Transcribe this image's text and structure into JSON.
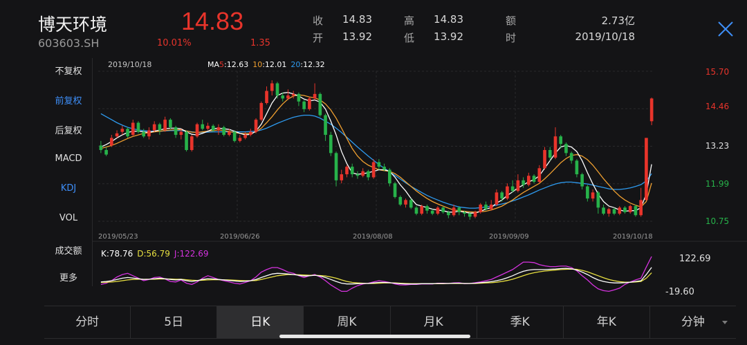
{
  "header": {
    "name": "博天环境",
    "code": "603603.SH",
    "price": "14.83",
    "change_pct": "10.01%",
    "change": "1.35",
    "quotes": [
      {
        "label": "收",
        "value": "14.83"
      },
      {
        "label": "高",
        "value": "14.83"
      },
      {
        "label": "额",
        "value": "2.73亿"
      },
      {
        "label": "开",
        "value": "13.92"
      },
      {
        "label": "低",
        "value": "13.92"
      },
      {
        "label": "时",
        "value": "2019/10/18"
      }
    ]
  },
  "sidebar": {
    "items": [
      {
        "label": "不复权"
      },
      {
        "label": "前复权",
        "active": true
      },
      {
        "label": "后复权"
      },
      {
        "label": "MACD"
      },
      {
        "label": "KDJ",
        "active": true
      },
      {
        "label": "VOL"
      },
      {
        "label": "成交额"
      },
      {
        "label": "更多"
      }
    ]
  },
  "legend": {
    "date": "2019/10/18",
    "ma_prefix": "MA",
    "ma5_key": "5",
    "ma5_val": ":12.63",
    "ma10_key": "10",
    "ma10_val": ":12.01",
    "ma20_key": "20",
    "ma20_val": ":12.32"
  },
  "kdj_legend": {
    "k": "K:78.76",
    "d": "D:56.79",
    "j": "J:122.69"
  },
  "tabs": [
    {
      "label": "分时"
    },
    {
      "label": "5日"
    },
    {
      "label": "日K",
      "active": true
    },
    {
      "label": "周K"
    },
    {
      "label": "月K"
    },
    {
      "label": "季K"
    },
    {
      "label": "年K"
    },
    {
      "label": "分钟",
      "dropdown": true
    }
  ],
  "colors": {
    "up": "#e8342b",
    "down": "#27b24a",
    "ma5": "#ffffff",
    "ma10": "#f0a030",
    "ma20": "#2e9bf0",
    "k_line": "#ffffff",
    "d_line": "#e8e040",
    "j_line": "#d633e0",
    "active_blue": "#3e8ef7"
  },
  "chart_data": {
    "type": "candlestick",
    "price_ticks": [
      "15.70",
      "14.46",
      "13.23",
      "11.99",
      "10.75"
    ],
    "ylim": [
      10.75,
      15.7
    ],
    "x_labels": [
      "2019/05/23",
      "2019/06/26",
      "2019/08/08",
      "2019/09/09",
      "2019/10/18"
    ],
    "kdj_ticks": [
      "122.69",
      "-19.60"
    ],
    "kdj_ylim": [
      -19.6,
      122.69
    ],
    "candles": [
      [
        13.25,
        13.1,
        13.4,
        13.0
      ],
      [
        13.1,
        12.95,
        13.2,
        12.9
      ],
      [
        13.25,
        13.5,
        13.6,
        13.2
      ],
      [
        13.55,
        13.65,
        13.75,
        13.5
      ],
      [
        13.7,
        13.8,
        13.9,
        13.6
      ],
      [
        13.8,
        13.55,
        13.85,
        13.5
      ],
      [
        13.6,
        14.0,
        14.1,
        13.55
      ],
      [
        14.0,
        13.7,
        14.05,
        13.65
      ],
      [
        13.7,
        13.55,
        13.8,
        13.5
      ],
      [
        13.55,
        13.75,
        13.85,
        13.45
      ],
      [
        13.75,
        13.95,
        14.05,
        13.7
      ],
      [
        13.95,
        13.75,
        14.0,
        13.6
      ],
      [
        13.75,
        14.1,
        14.2,
        13.7
      ],
      [
        14.1,
        13.85,
        14.15,
        13.8
      ],
      [
        13.85,
        13.6,
        13.9,
        13.5
      ],
      [
        13.6,
        13.7,
        13.8,
        13.45
      ],
      [
        13.7,
        13.1,
        13.75,
        13.05
      ],
      [
        13.1,
        13.55,
        13.6,
        13.05
      ],
      [
        13.55,
        13.95,
        14.0,
        13.5
      ],
      [
        13.95,
        13.8,
        14.1,
        13.75
      ],
      [
        13.8,
        13.9,
        14.0,
        13.75
      ],
      [
        13.9,
        13.75,
        13.95,
        13.7
      ],
      [
        13.75,
        13.85,
        13.95,
        13.6
      ],
      [
        13.85,
        13.6,
        13.9,
        13.55
      ],
      [
        13.6,
        13.7,
        13.8,
        13.55
      ],
      [
        13.7,
        13.4,
        13.75,
        13.35
      ],
      [
        13.4,
        13.5,
        13.6,
        13.35
      ],
      [
        13.5,
        13.6,
        13.7,
        13.45
      ],
      [
        13.6,
        13.7,
        13.8,
        13.55
      ],
      [
        13.7,
        14.1,
        14.15,
        13.65
      ],
      [
        14.1,
        14.65,
        14.7,
        14.05
      ],
      [
        14.65,
        15.05,
        15.2,
        14.6
      ],
      [
        15.05,
        15.3,
        15.4,
        14.9
      ],
      [
        15.3,
        14.9,
        15.35,
        14.8
      ],
      [
        14.9,
        14.8,
        15.0,
        14.7
      ],
      [
        14.8,
        14.9,
        15.1,
        14.75
      ],
      [
        14.9,
        14.95,
        15.05,
        14.8
      ],
      [
        14.95,
        14.7,
        15.0,
        14.55
      ],
      [
        14.7,
        14.45,
        14.75,
        14.35
      ],
      [
        14.45,
        14.8,
        14.85,
        14.4
      ],
      [
        14.8,
        14.95,
        15.3,
        14.75
      ],
      [
        14.95,
        14.25,
        15.0,
        14.2
      ],
      [
        14.25,
        13.6,
        14.3,
        13.4
      ],
      [
        13.6,
        13.0,
        13.7,
        12.9
      ],
      [
        13.0,
        12.1,
        13.05,
        11.9
      ],
      [
        12.1,
        12.3,
        12.45,
        12.0
      ],
      [
        12.3,
        12.55,
        12.6,
        12.2
      ],
      [
        12.55,
        12.3,
        12.65,
        12.2
      ],
      [
        12.3,
        12.25,
        12.4,
        12.15
      ],
      [
        12.25,
        12.4,
        12.5,
        12.2
      ],
      [
        12.4,
        12.2,
        12.45,
        12.1
      ],
      [
        12.2,
        12.7,
        12.8,
        12.15
      ],
      [
        12.7,
        12.55,
        12.8,
        12.45
      ],
      [
        12.55,
        12.45,
        12.65,
        12.4
      ],
      [
        12.45,
        12.0,
        12.5,
        11.9
      ],
      [
        12.0,
        11.55,
        12.05,
        11.5
      ],
      [
        11.55,
        11.3,
        11.6,
        11.25
      ],
      [
        11.3,
        11.45,
        11.5,
        11.2
      ],
      [
        11.45,
        11.2,
        11.5,
        11.15
      ],
      [
        11.2,
        11.0,
        11.25,
        10.95
      ],
      [
        11.0,
        11.25,
        11.3,
        10.95
      ],
      [
        11.25,
        11.1,
        11.3,
        11.0
      ],
      [
        11.1,
        11.0,
        11.15,
        10.95
      ],
      [
        11.0,
        11.2,
        11.25,
        10.95
      ],
      [
        11.2,
        11.05,
        11.25,
        11.0
      ],
      [
        11.05,
        10.95,
        11.1,
        10.85
      ],
      [
        10.95,
        11.2,
        11.3,
        10.9
      ],
      [
        11.2,
        11.05,
        11.25,
        10.95
      ],
      [
        11.05,
        11.0,
        11.1,
        10.9
      ],
      [
        11.0,
        10.9,
        11.05,
        10.8
      ],
      [
        10.9,
        11.05,
        11.1,
        10.85
      ],
      [
        11.05,
        11.3,
        11.35,
        11.0
      ],
      [
        11.3,
        11.15,
        11.4,
        11.1
      ],
      [
        11.15,
        11.3,
        11.45,
        11.1
      ],
      [
        11.3,
        11.7,
        11.8,
        11.25
      ],
      [
        11.7,
        11.5,
        11.75,
        11.4
      ],
      [
        11.5,
        11.9,
        12.0,
        11.45
      ],
      [
        11.9,
        11.75,
        12.1,
        11.7
      ],
      [
        11.75,
        12.1,
        12.3,
        11.7
      ],
      [
        12.1,
        11.95,
        12.2,
        11.85
      ],
      [
        11.95,
        12.25,
        12.35,
        11.9
      ],
      [
        12.25,
        12.05,
        12.3,
        12.0
      ],
      [
        12.05,
        12.5,
        12.6,
        12.0
      ],
      [
        12.5,
        13.1,
        13.2,
        12.45
      ],
      [
        13.1,
        12.85,
        13.2,
        12.75
      ],
      [
        12.85,
        13.55,
        13.85,
        12.8
      ],
      [
        13.55,
        13.3,
        13.6,
        13.15
      ],
      [
        13.3,
        13.0,
        13.35,
        12.9
      ],
      [
        13.0,
        12.75,
        13.05,
        12.65
      ],
      [
        12.75,
        12.3,
        12.8,
        12.2
      ],
      [
        12.3,
        11.9,
        12.35,
        11.8
      ],
      [
        11.9,
        11.5,
        11.95,
        11.4
      ],
      [
        11.5,
        11.7,
        11.8,
        11.4
      ],
      [
        11.7,
        11.2,
        11.75,
        11.0
      ],
      [
        11.2,
        11.0,
        11.3,
        10.95
      ],
      [
        11.0,
        11.15,
        11.2,
        10.9
      ],
      [
        11.15,
        11.0,
        11.2,
        10.95
      ],
      [
        11.0,
        11.2,
        11.25,
        10.95
      ],
      [
        11.2,
        11.05,
        11.25,
        11.0
      ],
      [
        11.05,
        11.25,
        11.3,
        11.0
      ],
      [
        11.25,
        10.95,
        11.3,
        10.9
      ],
      [
        10.95,
        11.45,
        11.85,
        10.9
      ],
      [
        11.45,
        13.5,
        13.5,
        11.45
      ],
      [
        14.05,
        14.8,
        14.83,
        13.92
      ]
    ],
    "ma5": [
      13.2,
      13.28,
      13.38,
      13.5,
      13.6,
      13.68,
      13.72,
      13.72,
      13.7,
      13.68,
      13.72,
      13.76,
      13.8,
      13.82,
      13.82,
      13.8,
      13.7,
      13.62,
      13.6,
      13.65,
      13.72,
      13.8,
      13.82,
      13.8,
      13.78,
      13.72,
      13.65,
      13.6,
      13.62,
      13.72,
      13.95,
      14.3,
      14.65,
      14.9,
      14.98,
      15.0,
      14.95,
      14.88,
      14.78,
      14.72,
      14.75,
      14.68,
      14.45,
      14.05,
      13.6,
      13.05,
      12.65,
      12.35,
      12.3,
      12.32,
      12.35,
      12.4,
      12.45,
      12.45,
      12.4,
      12.2,
      11.95,
      11.75,
      11.5,
      11.3,
      11.25,
      11.2,
      11.15,
      11.12,
      11.1,
      11.05,
      11.05,
      11.08,
      11.05,
      11.02,
      11.02,
      11.08,
      11.15,
      11.2,
      11.35,
      11.45,
      11.6,
      11.72,
      11.85,
      11.95,
      12.05,
      12.12,
      12.25,
      12.5,
      12.75,
      13.0,
      13.2,
      13.25,
      13.2,
      13.05,
      12.75,
      12.35,
      11.98,
      11.65,
      11.4,
      11.25,
      11.2,
      11.12,
      11.08,
      11.1,
      11.1,
      11.2,
      11.65,
      12.63
    ],
    "ma10": [
      13.15,
      13.2,
      13.25,
      13.32,
      13.4,
      13.48,
      13.55,
      13.6,
      13.65,
      13.67,
      13.7,
      13.72,
      13.74,
      13.76,
      13.77,
      13.77,
      13.73,
      13.69,
      13.68,
      13.7,
      13.72,
      13.74,
      13.76,
      13.74,
      13.71,
      13.68,
      13.65,
      13.64,
      13.65,
      13.7,
      13.82,
      14.0,
      14.2,
      14.42,
      14.62,
      14.78,
      14.88,
      14.92,
      14.9,
      14.85,
      14.82,
      14.75,
      14.62,
      14.42,
      14.15,
      13.82,
      13.48,
      13.15,
      12.9,
      12.72,
      12.6,
      12.52,
      12.45,
      12.42,
      12.4,
      12.32,
      12.2,
      12.05,
      11.9,
      11.75,
      11.62,
      11.5,
      11.4,
      11.32,
      11.25,
      11.18,
      11.12,
      11.1,
      11.08,
      11.06,
      11.05,
      11.06,
      11.08,
      11.12,
      11.18,
      11.25,
      11.35,
      11.45,
      11.58,
      11.7,
      11.8,
      11.9,
      12.0,
      12.15,
      12.32,
      12.5,
      12.68,
      12.82,
      12.92,
      12.95,
      12.9,
      12.78,
      12.6,
      12.38,
      12.15,
      11.95,
      11.75,
      11.58,
      11.45,
      11.35,
      11.28,
      11.22,
      11.4,
      12.01
    ],
    "ma20": [
      14.3,
      14.2,
      14.1,
      14.0,
      13.92,
      13.85,
      13.8,
      13.76,
      13.74,
      13.72,
      13.72,
      13.72,
      13.73,
      13.74,
      13.74,
      13.74,
      13.72,
      13.7,
      13.68,
      13.68,
      13.69,
      13.7,
      13.7,
      13.7,
      13.7,
      13.7,
      13.7,
      13.7,
      13.71,
      13.72,
      13.76,
      13.82,
      13.9,
      13.98,
      14.05,
      14.12,
      14.18,
      14.22,
      14.25,
      14.25,
      14.22,
      14.15,
      14.05,
      13.95,
      13.82,
      13.68,
      13.52,
      13.36,
      13.2,
      13.05,
      12.9,
      12.76,
      12.62,
      12.5,
      12.38,
      12.26,
      12.14,
      12.02,
      11.9,
      11.8,
      11.7,
      11.6,
      11.52,
      11.45,
      11.38,
      11.32,
      11.27,
      11.22,
      11.2,
      11.18,
      11.18,
      11.2,
      11.22,
      11.25,
      11.28,
      11.32,
      11.36,
      11.42,
      11.48,
      11.55,
      11.62,
      11.7,
      11.78,
      11.85,
      11.92,
      11.98,
      12.02,
      12.04,
      12.04,
      12.02,
      12.0,
      11.98,
      11.94,
      11.9,
      11.86,
      11.82,
      11.8,
      11.8,
      11.82,
      11.85,
      11.9,
      11.96,
      12.08,
      12.32
    ],
    "k": [
      20,
      22,
      25,
      30,
      35,
      38,
      36,
      33,
      30,
      31,
      33,
      35,
      33,
      30,
      28,
      30,
      25,
      22,
      25,
      30,
      33,
      32,
      30,
      28,
      26,
      24,
      22,
      23,
      25,
      30,
      38,
      45,
      52,
      55,
      54,
      52,
      50,
      47,
      44,
      45,
      47,
      44,
      38,
      30,
      22,
      15,
      12,
      12,
      13,
      14,
      14,
      16,
      18,
      18,
      17,
      15,
      13,
      12,
      12,
      12,
      13,
      13,
      13,
      14,
      14,
      14,
      15,
      15,
      14,
      14,
      15,
      17,
      19,
      21,
      25,
      30,
      37,
      45,
      55,
      63,
      68,
      70,
      70,
      70,
      71,
      72,
      74,
      75,
      73,
      68,
      60,
      50,
      38,
      28,
      22,
      18,
      16,
      16,
      17,
      19,
      22,
      25,
      50,
      78.76
    ],
    "d": [
      18,
      19,
      20,
      22,
      25,
      28,
      30,
      31,
      31,
      31,
      31,
      32,
      32,
      32,
      31,
      31,
      29,
      27,
      26,
      27,
      28,
      29,
      29,
      29,
      28,
      27,
      26,
      25,
      25,
      26,
      30,
      35,
      40,
      45,
      48,
      50,
      50,
      49,
      48,
      47,
      47,
      46,
      44,
      40,
      35,
      28,
      22,
      18,
      16,
      15,
      14,
      14,
      15,
      16,
      16,
      16,
      15,
      14,
      13,
      13,
      13,
      13,
      13,
      13,
      13,
      14,
      14,
      14,
      14,
      14,
      14,
      15,
      16,
      17,
      19,
      22,
      26,
      31,
      38,
      45,
      52,
      57,
      61,
      64,
      66,
      68,
      70,
      71,
      72,
      71,
      67,
      61,
      53,
      45,
      37,
      30,
      25,
      21,
      19,
      19,
      20,
      22,
      35,
      56.79
    ],
    "j": [
      10,
      15,
      25,
      40,
      50,
      55,
      45,
      35,
      25,
      30,
      38,
      40,
      32,
      22,
      20,
      28,
      15,
      10,
      20,
      35,
      45,
      38,
      30,
      25,
      20,
      15,
      12,
      18,
      25,
      40,
      60,
      70,
      78,
      78,
      70,
      60,
      55,
      45,
      38,
      45,
      50,
      40,
      25,
      8,
      -5,
      -18,
      -18,
      -5,
      5,
      12,
      15,
      20,
      25,
      22,
      18,
      12,
      8,
      8,
      10,
      10,
      12,
      12,
      12,
      15,
      15,
      14,
      16,
      17,
      13,
      14,
      17,
      20,
      25,
      30,
      40,
      50,
      60,
      70,
      85,
      100,
      100,
      98,
      90,
      85,
      82,
      82,
      84,
      84,
      78,
      65,
      45,
      28,
      8,
      -8,
      -15,
      -18,
      -12,
      -5,
      10,
      20,
      28,
      35,
      80,
      122.69
    ]
  }
}
